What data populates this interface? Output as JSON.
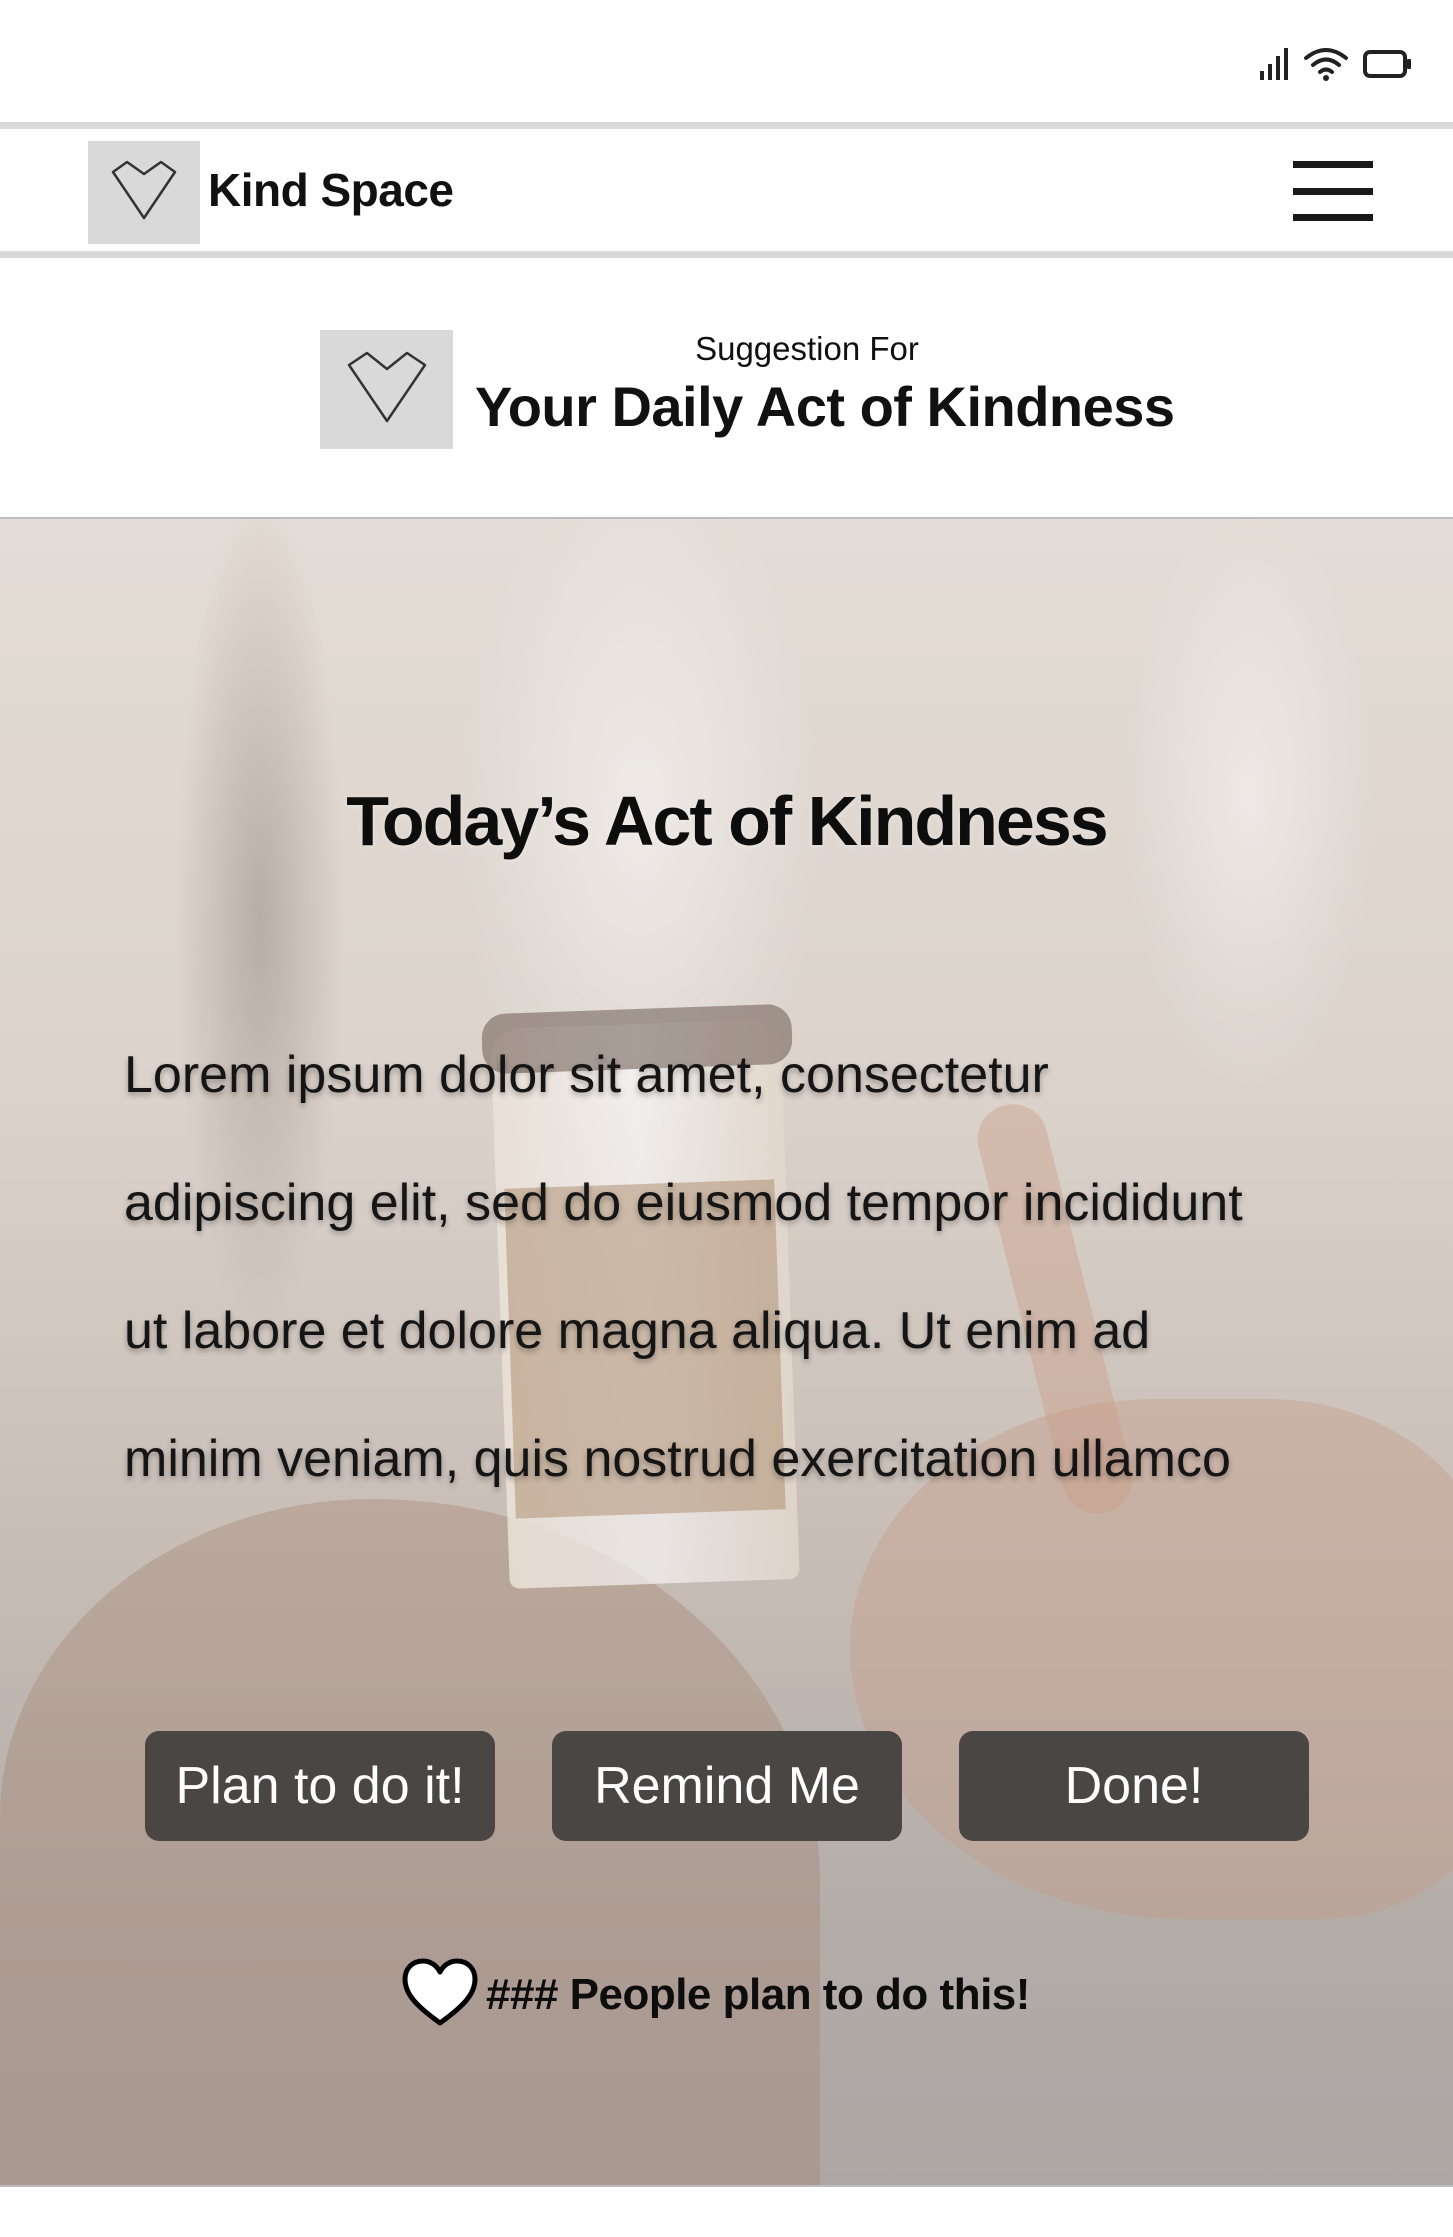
{
  "status_bar": {
    "icons": [
      "signal-icon",
      "wifi-icon",
      "battery-icon"
    ]
  },
  "header": {
    "brand_name": "Kind Space",
    "logo_icon": "heart-outline-icon",
    "menu_icon": "hamburger-menu-icon"
  },
  "suggestion": {
    "subtitle": "Suggestion For",
    "title": "Your Daily Act of Kindness",
    "logo_icon": "heart-outline-icon"
  },
  "hero": {
    "title": "Today’s Act of Kindness",
    "body_lines": [
      "Lorem ipsum dolor sit amet, consectetur",
      "adipiscing elit, sed do eiusmod tempor incididunt",
      "ut labore et dolore magna aliqua. Ut enim ad",
      "minim veniam, quis nostrud exercitation ullamco"
    ],
    "actions": {
      "plan_label": "Plan to do it!",
      "remind_label": "Remind Me",
      "done_label": "Done!"
    },
    "plan_count_text": "### People plan to do this!",
    "plan_count_icon": "heart-icon"
  },
  "colors": {
    "button_bg": "#4a4644",
    "button_text": "#ffffff",
    "logo_bg": "#d9d9d9",
    "divider": "#d9d9d9"
  }
}
